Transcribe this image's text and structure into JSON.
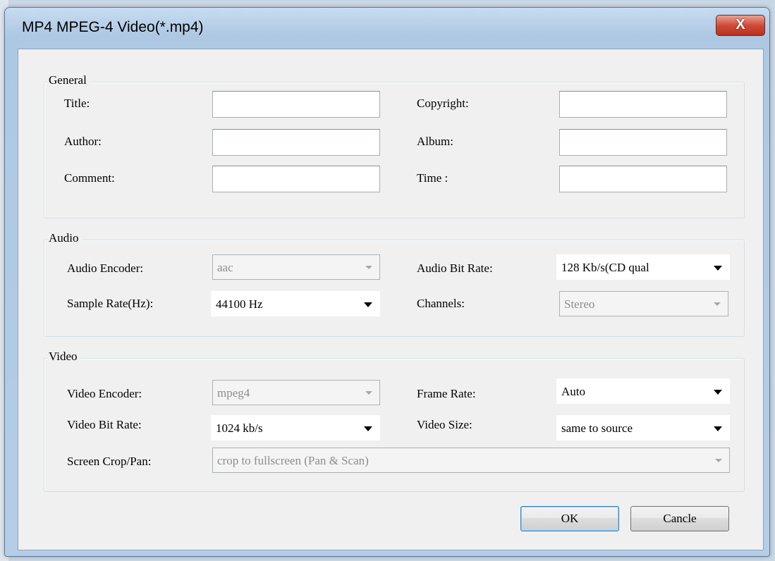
{
  "window": {
    "title": "MP4 MPEG-4 Video(*.mp4)",
    "close_glyph": "X"
  },
  "general": {
    "legend": "General",
    "title_label": "Title:",
    "author_label": "Author:",
    "comment_label": "Comment:",
    "copyright_label": "Copyright:",
    "album_label": "Album:",
    "time_label": "Time :",
    "title_value": "",
    "author_value": "",
    "comment_value": "",
    "copyright_value": "",
    "album_value": "",
    "time_value": ""
  },
  "audio": {
    "legend": "Audio",
    "encoder_label": "Audio Encoder:",
    "encoder_value": "aac",
    "bitrate_label": "Audio Bit Rate:",
    "bitrate_value": "128 Kb/s(CD qual",
    "samplerate_label": "Sample Rate(Hz):",
    "samplerate_value": "44100 Hz",
    "channels_label": "Channels:",
    "channels_value": "Stereo"
  },
  "video": {
    "legend": "Video",
    "encoder_label": "Video Encoder:",
    "encoder_value": "mpeg4",
    "framerate_label": "Frame Rate:",
    "framerate_value": "Auto",
    "bitrate_label": "Video Bit Rate:",
    "bitrate_value": "1024 kb/s",
    "size_label": "Video Size:",
    "size_value": "same to source",
    "crop_label": "Screen Crop/Pan:",
    "crop_value": "crop to fullscreen (Pan & Scan)"
  },
  "buttons": {
    "ok": "OK",
    "cancel": "Cancle"
  },
  "colors": {
    "title_bar": "#b5cde6",
    "close_button": "#cf4b37",
    "dialog_bg": "#f0f0f0",
    "default_button_border": "#3c7fb1"
  }
}
